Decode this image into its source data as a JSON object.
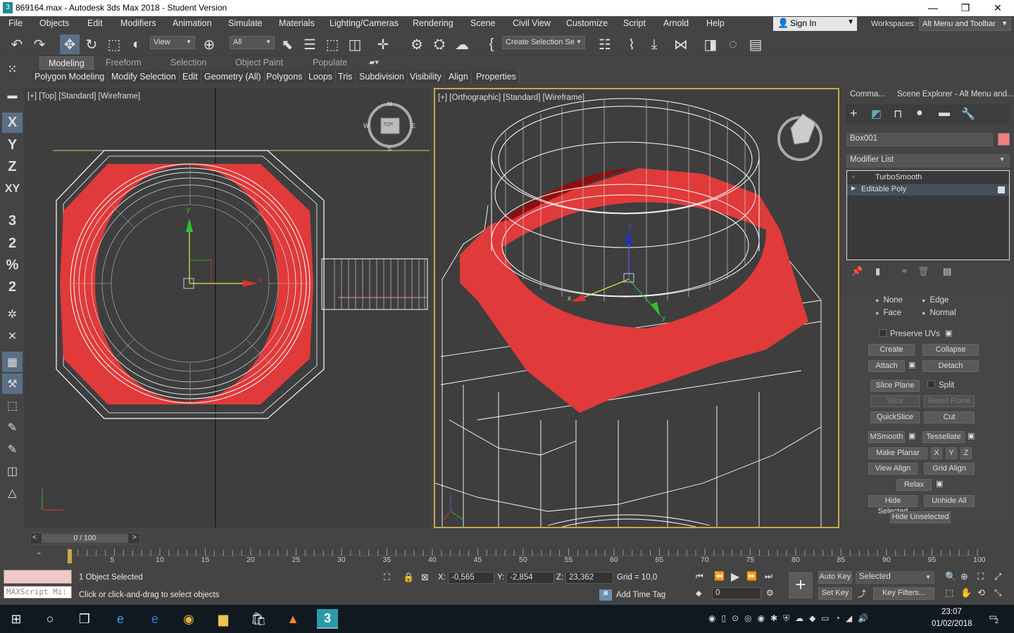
{
  "window": {
    "title": "869164.max - Autodesk 3ds Max 2018 - Student Version",
    "app_icon": "3",
    "minimize": "—",
    "maximize": "❐",
    "close": "✕"
  },
  "menu": {
    "items": [
      "File",
      "Objects",
      "Edit",
      "Modifiers",
      "Animation",
      "Simulate",
      "Materials",
      "Lighting/Cameras",
      "Rendering",
      "Scene",
      "Civil View",
      "Customize",
      "Script",
      "Arnold",
      "Help"
    ],
    "sign_in": "Sign In",
    "workspaces_label": "Workspaces:",
    "workspace_value": "Alt Menu and Toolbar"
  },
  "toolbar": {
    "view_dropdown": "View",
    "filter_dropdown": "All",
    "selection_set_dropdown": "Create Selection Se"
  },
  "ribbon": {
    "tabs": [
      "Modeling",
      "Freeform",
      "Selection",
      "Object Paint",
      "Populate"
    ],
    "active_tab": "Modeling",
    "panels": [
      "Polygon Modeling",
      "Modify Selection",
      "Edit",
      "Geometry (All)",
      "Polygons",
      "Loops",
      "Tris",
      "Subdivision",
      "Visibility",
      "Align",
      "Properties"
    ]
  },
  "left_strip": {
    "axis_x": "X",
    "axis_y": "Y",
    "axis_z": "Z",
    "axis_xy": "XY",
    "snap_3": "3",
    "snap_angle": "2",
    "snap_percent": "%",
    "snap_spinner": "2"
  },
  "viewports": {
    "top": {
      "label": "[+] [Top] [Standard] [Wireframe]",
      "viewcube_label": "TOP",
      "compass_n": "N",
      "compass_s": "S",
      "compass_e": "E",
      "compass_w": "W",
      "gizmo_x": "x",
      "gizmo_y": "y"
    },
    "ortho": {
      "label": "[+] [Orthographic] [Standard] [Wireframe]",
      "gizmo_x": "x",
      "gizmo_y": "y",
      "gizmo_z": "z"
    }
  },
  "command_panel": {
    "tabs": [
      "Comma...",
      "Scene Explorer - Alt Menu and..."
    ],
    "object_name": "Box001",
    "object_color": "#f08080",
    "modifier_list": "Modifier List",
    "stack": [
      "TurboSmooth",
      "Editable Poly"
    ],
    "constraints": [
      "None",
      "Edge",
      "Face",
      "Normal"
    ],
    "preserve_uvs": "Preserve UVs",
    "buttons": {
      "create": "Create",
      "collapse": "Collapse",
      "attach": "Attach",
      "detach": "Detach",
      "slice_plane": "Slice Plane",
      "split": "Split",
      "slice": "Slice",
      "reset_plane": "Reset Plane",
      "quickslice": "QuickSlice",
      "cut": "Cut",
      "msmooth": "MSmooth",
      "tessellate": "Tessellate",
      "make_planar": "Make Planar",
      "x": "X",
      "y": "Y",
      "z": "Z",
      "view_align": "View Align",
      "grid_align": "Grid Align",
      "relax": "Relax",
      "hide_selected": "Hide Selected",
      "unhide_all": "Unhide All",
      "hide_unselected": "Hide Unselected"
    }
  },
  "timeline": {
    "frame_display": "0 / 100",
    "prev": "<",
    "next": ">",
    "ticks": [
      "5",
      "10",
      "15",
      "20",
      "25",
      "30",
      "35",
      "40",
      "45",
      "50",
      "55",
      "60",
      "65",
      "70",
      "75",
      "80",
      "85",
      "90",
      "95",
      "100"
    ]
  },
  "status": {
    "maxscript": "MAXScript Mi:",
    "objects_selected": "1 Object Selected",
    "prompt": "Click or click-and-drag to select objects",
    "x_label": "X:",
    "x_value": "-0,565",
    "y_label": "Y:",
    "y_value": "-2,854",
    "z_label": "Z:",
    "z_value": "23,362",
    "grid": "Grid = 10,0",
    "add_time_tag": "Add Time Tag",
    "auto_key": "Auto Key",
    "selected_dropdown": "Selected",
    "set_key": "Set Key",
    "key_filters": "Key Filters...",
    "frame_field": "0"
  },
  "taskbar": {
    "time": "23:07",
    "date": "01/02/2018",
    "notifications": "2"
  },
  "colors": {
    "selection_red": "#e03a3a",
    "accent_blue": "#5a6f86",
    "viewport_bg": "#3e3e3e",
    "active_border": "#c8a84a"
  }
}
